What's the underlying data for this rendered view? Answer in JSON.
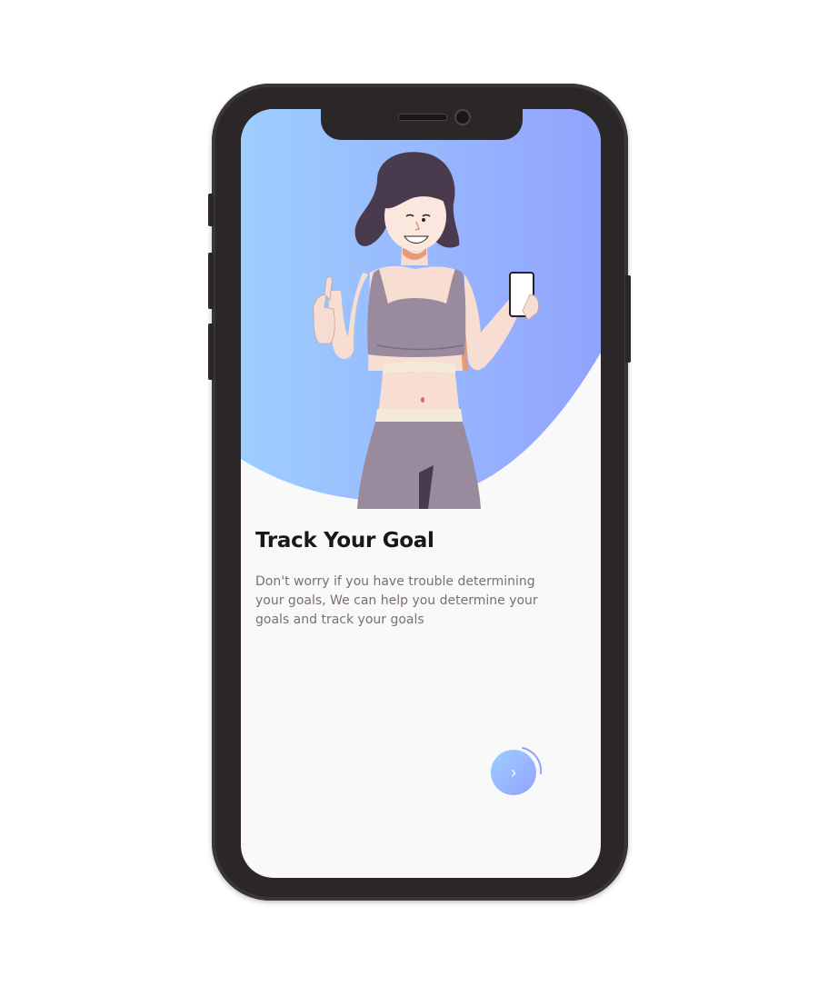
{
  "onboarding": {
    "title": "Track Your Goal",
    "description": "Don't worry if you have trouble determining your goals, We can help you determine your goals and track your goals",
    "next_glyph": "›"
  },
  "icons": {
    "next": "chevron-right-icon",
    "camera": "front-camera-icon",
    "speaker": "earpiece-speaker-icon"
  },
  "colors": {
    "gradient_start": "#9DCEFF",
    "gradient_end": "#92A3FD",
    "title_text": "#1D1617",
    "body_text": "#7B6F72",
    "screen_bg": "#F9F9F9",
    "phone_frame": "#2B2728"
  }
}
